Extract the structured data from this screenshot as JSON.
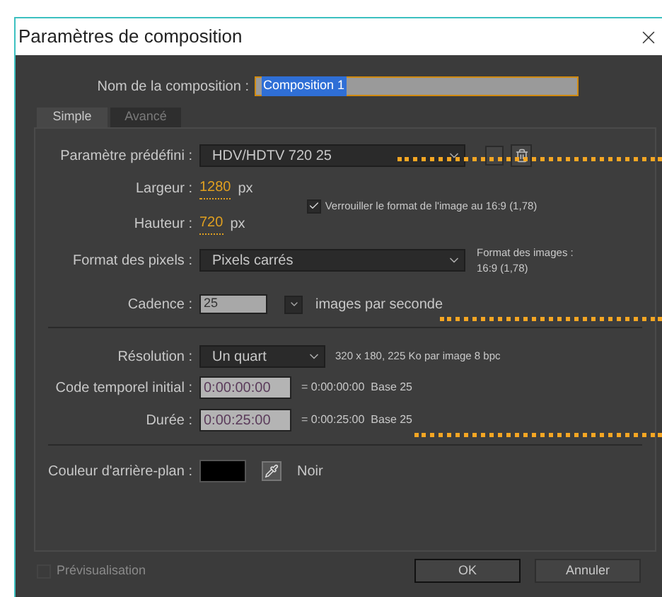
{
  "window": {
    "title": "Paramètres de composition"
  },
  "composition_name": {
    "label": "Nom de la composition :",
    "value": "Composition 1"
  },
  "tabs": [
    {
      "label": "Simple",
      "selected": true
    },
    {
      "label": "Avancé",
      "selected": false
    }
  ],
  "preset": {
    "label": "Paramètre prédéfini :",
    "value": "HDV/HDTV 720 25"
  },
  "width": {
    "label": "Largeur :",
    "value": "1280",
    "unit": "px"
  },
  "height": {
    "label": "Hauteur :",
    "value": "720",
    "unit": "px"
  },
  "lock_aspect": {
    "label": "Verrouiller le format de l'image au 16:9 (1,78)",
    "checked": true
  },
  "pixel_aspect": {
    "label": "Format des pixels :",
    "value": "Pixels carrés",
    "frame_aspect_label": "Format des images :",
    "frame_aspect_value": "16:9 (1,78)"
  },
  "frame_rate": {
    "label": "Cadence :",
    "value": "25",
    "unit": "images par seconde"
  },
  "resolution": {
    "label": "Résolution :",
    "value": "Un quart",
    "info": "320 x 180, 225 Ko par image 8 bpc"
  },
  "start_timecode": {
    "label": "Code temporel initial :",
    "value": "0:00:00:00",
    "info": "= 0:00:00:00  Base 25"
  },
  "duration": {
    "label": "Durée :",
    "value": "0:00:25:00",
    "info": "= 0:00:25:00  Base 25"
  },
  "background_color": {
    "label": "Couleur d'arrière-plan :",
    "color": "#000000",
    "name": "Noir"
  },
  "preview": {
    "label": "Prévisualisation",
    "checked": false,
    "disabled": true
  },
  "buttons": [
    {
      "label": "OK",
      "default": true
    },
    {
      "label": "Annuler",
      "default": false
    }
  ]
}
